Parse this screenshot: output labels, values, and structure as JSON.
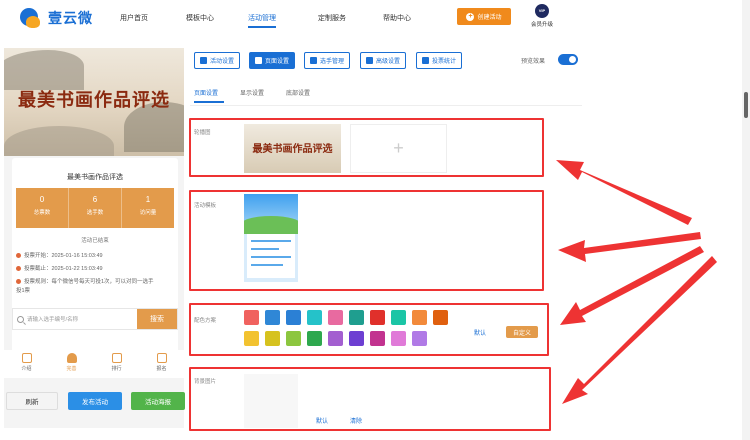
{
  "brand": {
    "name": "壹云微"
  },
  "nav": {
    "items": [
      "用户首页",
      "模板中心",
      "活动管理",
      "定制服务",
      "帮助中心"
    ],
    "active_index": 2,
    "create_label": "创建活动",
    "vip_badge": "VIP",
    "vip_label": "会员升级"
  },
  "phone": {
    "banner_title": "最美书画作品评选",
    "activity_title": "最美书画作品评选",
    "stats": [
      {
        "value": "0",
        "label": "总票数"
      },
      {
        "value": "6",
        "label": "选手数"
      },
      {
        "value": "1",
        "label": "访问量"
      }
    ],
    "status": "活动已结束",
    "info": [
      "投票开始：2025-01-16 15:03:49",
      "投票截止：2025-01-22 15:03:49",
      "投票规则：每个微信号每天可投1次，可以对同一选手投1票"
    ],
    "search_placeholder": "请输入选手编号/名称",
    "search_button": "搜索",
    "tabs": [
      "介绍",
      "完善",
      "排行",
      "报名"
    ],
    "active_tab": 1
  },
  "bottom_actions": {
    "refresh": "刷新",
    "publish": "发布活动",
    "poster": "活动海报"
  },
  "toolbar": {
    "buttons": [
      "活动设置",
      "页面设置",
      "选手管理",
      "高级设置",
      "投票统计"
    ],
    "active_index": 1,
    "preview_label": "预览效果",
    "preview_on": true
  },
  "subtabs": {
    "items": [
      "页面设置",
      "显示设置",
      "底部设置"
    ],
    "active_index": 0
  },
  "sections": {
    "carousel_label": "轮播图",
    "carousel_image_text": "最美书画作品评选",
    "carousel_add": "+",
    "template_label": "活动模板",
    "scheme_label": "配色方案",
    "scheme_default": "默认",
    "scheme_custom": "自定义",
    "background_label": "背景图片",
    "background_default": "默认",
    "background_clear": "清除"
  },
  "colors": {
    "accent": "#1a6fd4",
    "orange": "#e39b4b",
    "green": "#52b44a",
    "swatches_row1": [
      "#f0625f",
      "#2f87d6",
      "#2b80d5",
      "#25c2c9",
      "#e86aa0",
      "#1f9e8f",
      "#e0302b",
      "#1bc5a6",
      "#f28a3b",
      "#e0600f"
    ],
    "swatches_row2": [
      "#f2c230",
      "#d6c21f",
      "#8cc63f",
      "#2ea84e",
      "#a35fd0",
      "#6d3fd2",
      "#c2338f",
      "#e07ad8",
      "#b07ae6"
    ]
  }
}
